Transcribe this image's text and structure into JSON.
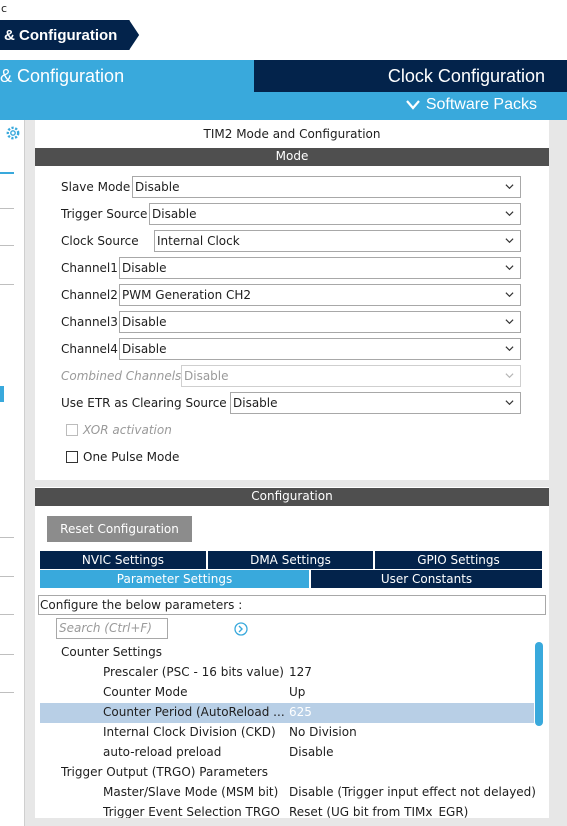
{
  "window": {
    "title": "c"
  },
  "breadcrumb": {
    "label": "& Configuration"
  },
  "tabs": {
    "pinout": "& Configuration",
    "clock": "Clock Configuration"
  },
  "software_packs": {
    "label": "Software Packs",
    "icon": "chevron-down-icon"
  },
  "mode_panel": {
    "title": "TIM2 Mode and Configuration",
    "section": "Mode",
    "rows": [
      {
        "label": "Slave Mode",
        "value": "Disable"
      },
      {
        "label": "Trigger Source",
        "value": "Disable"
      },
      {
        "label": "Clock Source",
        "value": "Internal Clock"
      },
      {
        "label": "Channel1",
        "value": "Disable"
      },
      {
        "label": "Channel2",
        "value": "PWM Generation CH2"
      },
      {
        "label": "Channel3",
        "value": "Disable"
      },
      {
        "label": "Channel4",
        "value": "Disable"
      },
      {
        "label": "Combined Channels",
        "value": "Disable"
      },
      {
        "label": "Use ETR as Clearing Source",
        "value": "Disable"
      }
    ],
    "checkboxes": [
      {
        "label": "XOR activation",
        "checked": false
      },
      {
        "label": "One Pulse Mode",
        "checked": false
      }
    ]
  },
  "config_panel": {
    "section": "Configuration",
    "reset_label": "Reset Configuration",
    "tabs_top": [
      "NVIC Settings",
      "DMA Settings",
      "GPIO Settings"
    ],
    "tabs_bottom": [
      "Parameter Settings",
      "User Constants"
    ],
    "info": "Configure the below parameters :",
    "search_placeholder": "Search (Ctrl+F)",
    "tree": [
      {
        "key": "Counter Settings",
        "value": ""
      },
      {
        "key": "Prescaler (PSC - 16 bits value)",
        "value": "127"
      },
      {
        "key": "Counter Mode",
        "value": "Up"
      },
      {
        "key": "Counter Period (AutoReload ...",
        "value": "625"
      },
      {
        "key": "Internal Clock Division (CKD)",
        "value": "No Division"
      },
      {
        "key": "auto-reload preload",
        "value": "Disable"
      },
      {
        "key": "Trigger Output (TRGO) Parameters",
        "value": ""
      },
      {
        "key": "Master/Slave Mode (MSM bit)",
        "value": "Disable (Trigger input effect not delayed)"
      },
      {
        "key": "Trigger Event Selection TRGO",
        "value": "Reset (UG bit from TIMx_EGR)"
      }
    ]
  },
  "colors": {
    "navy": "#03234b",
    "accent": "#39a9dc",
    "section_bar": "#4f4f4f",
    "selected_row": "#b8cfe6"
  }
}
